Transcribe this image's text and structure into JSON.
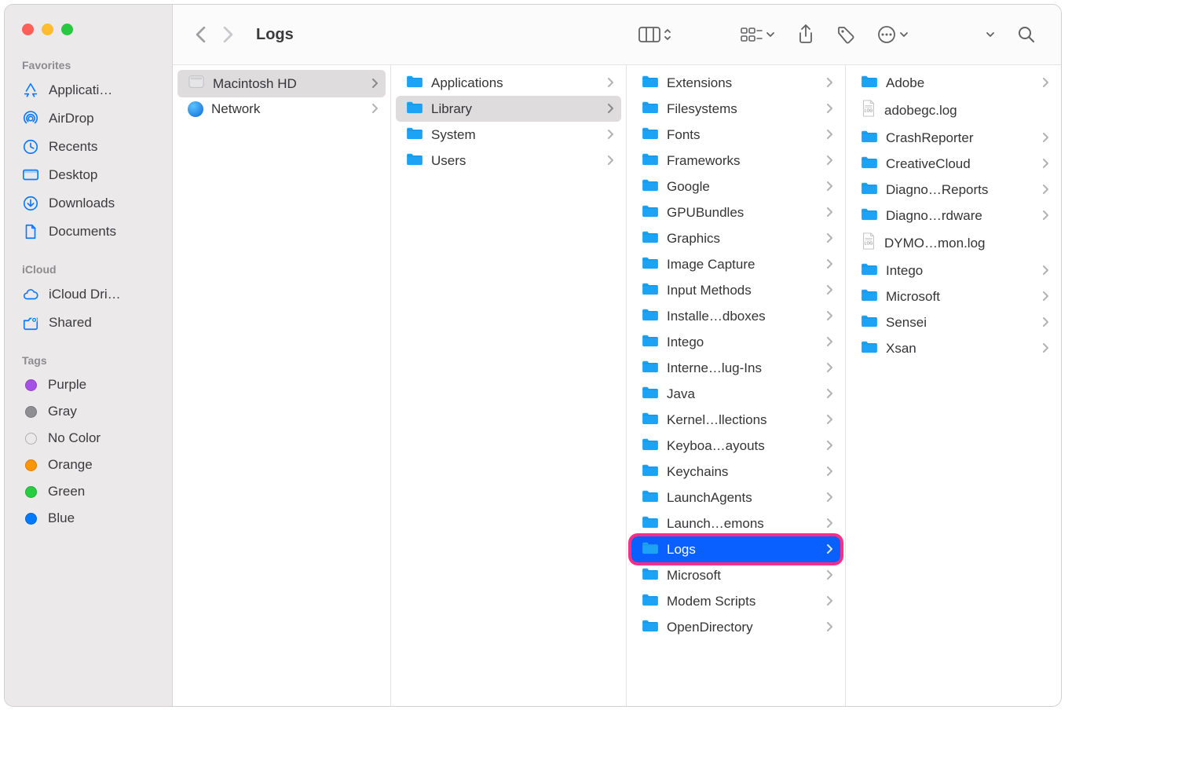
{
  "window_title": "Logs",
  "sidebar": {
    "sections": [
      {
        "label": "Favorites",
        "items": [
          {
            "icon": "appstore",
            "label": "Applicati…"
          },
          {
            "icon": "airdrop",
            "label": "AirDrop"
          },
          {
            "icon": "recents",
            "label": "Recents"
          },
          {
            "icon": "desktop",
            "label": "Desktop"
          },
          {
            "icon": "download",
            "label": "Downloads"
          },
          {
            "icon": "document",
            "label": "Documents"
          }
        ]
      },
      {
        "label": "iCloud",
        "items": [
          {
            "icon": "cloud",
            "label": "iCloud Dri…"
          },
          {
            "icon": "shared",
            "label": "Shared"
          }
        ]
      },
      {
        "label": "Tags",
        "items": [
          {
            "icon": "tag",
            "color": "#a550e6",
            "label": "Purple"
          },
          {
            "icon": "tag",
            "color": "#8e8e93",
            "label": "Gray"
          },
          {
            "icon": "tag",
            "color": "transparent",
            "stroke": "#b0b0b0",
            "label": "No Color"
          },
          {
            "icon": "tag",
            "color": "#ff9500",
            "label": "Orange"
          },
          {
            "icon": "tag",
            "color": "#28cd41",
            "label": "Green"
          },
          {
            "icon": "tag",
            "color": "#007aff",
            "label": "Blue"
          }
        ]
      }
    ]
  },
  "columns": [
    [
      {
        "type": "hd",
        "label": "Macintosh HD",
        "has_children": true,
        "selected": "path"
      },
      {
        "type": "globe",
        "label": "Network",
        "has_children": true
      }
    ],
    [
      {
        "type": "folder",
        "label": "Applications",
        "has_children": true
      },
      {
        "type": "folder",
        "label": "Library",
        "has_children": true,
        "selected": "path"
      },
      {
        "type": "folder",
        "label": "System",
        "has_children": true
      },
      {
        "type": "folder",
        "label": "Users",
        "has_children": true
      }
    ],
    [
      {
        "type": "folder",
        "label": "Extensions",
        "has_children": true
      },
      {
        "type": "folder",
        "label": "Filesystems",
        "has_children": true
      },
      {
        "type": "folder",
        "label": "Fonts",
        "has_children": true
      },
      {
        "type": "folder",
        "label": "Frameworks",
        "has_children": true
      },
      {
        "type": "folder",
        "label": "Google",
        "has_children": true
      },
      {
        "type": "folder",
        "label": "GPUBundles",
        "has_children": true
      },
      {
        "type": "folder",
        "label": "Graphics",
        "has_children": true
      },
      {
        "type": "folder",
        "label": "Image Capture",
        "has_children": true
      },
      {
        "type": "folder",
        "label": "Input Methods",
        "has_children": true
      },
      {
        "type": "folder",
        "label": "Installe…dboxes",
        "has_children": true
      },
      {
        "type": "folder",
        "label": "Intego",
        "has_children": true
      },
      {
        "type": "folder",
        "label": "Interne…lug-Ins",
        "has_children": true
      },
      {
        "type": "folder",
        "label": "Java",
        "has_children": true
      },
      {
        "type": "folder",
        "label": "Kernel…llections",
        "has_children": true
      },
      {
        "type": "folder",
        "label": "Keyboa…ayouts",
        "has_children": true
      },
      {
        "type": "folder",
        "label": "Keychains",
        "has_children": true
      },
      {
        "type": "folder",
        "label": "LaunchAgents",
        "has_children": true
      },
      {
        "type": "folder",
        "label": "Launch…emons",
        "has_children": true
      },
      {
        "type": "folder",
        "label": "Logs",
        "has_children": true,
        "selected": "active",
        "highlight": true
      },
      {
        "type": "folder",
        "label": "Microsoft",
        "has_children": true
      },
      {
        "type": "folder",
        "label": "Modem Scripts",
        "has_children": true
      },
      {
        "type": "folder",
        "label": "OpenDirectory",
        "has_children": true
      }
    ],
    [
      {
        "type": "folder",
        "label": "Adobe",
        "has_children": true
      },
      {
        "type": "log",
        "label": "adobegc.log",
        "has_children": false
      },
      {
        "type": "folder",
        "label": "CrashReporter",
        "has_children": true
      },
      {
        "type": "folder",
        "label": "CreativeCloud",
        "has_children": true
      },
      {
        "type": "folder",
        "label": "Diagno…Reports",
        "has_children": true
      },
      {
        "type": "folder",
        "label": "Diagno…rdware",
        "has_children": true
      },
      {
        "type": "log",
        "label": "DYMO…mon.log",
        "has_children": false
      },
      {
        "type": "folder",
        "label": "Intego",
        "has_children": true
      },
      {
        "type": "folder",
        "label": "Microsoft",
        "has_children": true
      },
      {
        "type": "folder",
        "label": "Sensei",
        "has_children": true
      },
      {
        "type": "folder",
        "label": "Xsan",
        "has_children": true
      }
    ]
  ],
  "colors": {
    "folder": "#1ca3f6",
    "accent": "#0a60ff",
    "highlight_ring": "#ff2d86"
  }
}
